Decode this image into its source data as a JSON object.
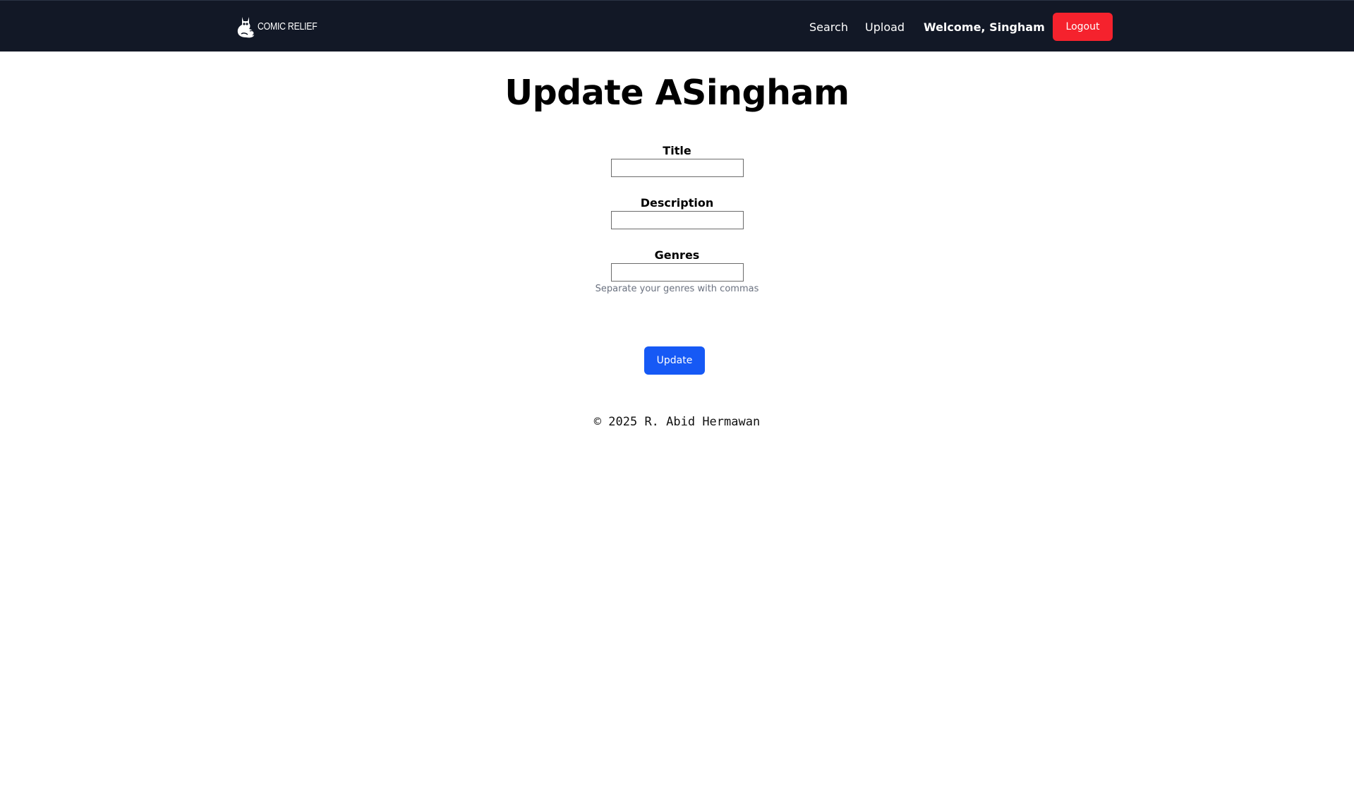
{
  "navbar": {
    "brand_text": "Comic Relief",
    "brand_icon": "cat-icon",
    "links": {
      "search": "Search",
      "upload": "Upload"
    },
    "welcome": "Welcome, Singham",
    "logout_label": "Logout",
    "colors": {
      "background": "#121826",
      "logout": "#f5222d"
    }
  },
  "page": {
    "title": "Update ASingham"
  },
  "form": {
    "title_label": "Title",
    "title_value": "",
    "description_label": "Description",
    "description_value": "",
    "genres_label": "Genres",
    "genres_value": "",
    "genres_hint": "Separate your genres with commas",
    "submit_label": "Update",
    "submit_color": "#1659f5"
  },
  "footer": {
    "text": "© 2025 R. Abid Hermawan"
  }
}
